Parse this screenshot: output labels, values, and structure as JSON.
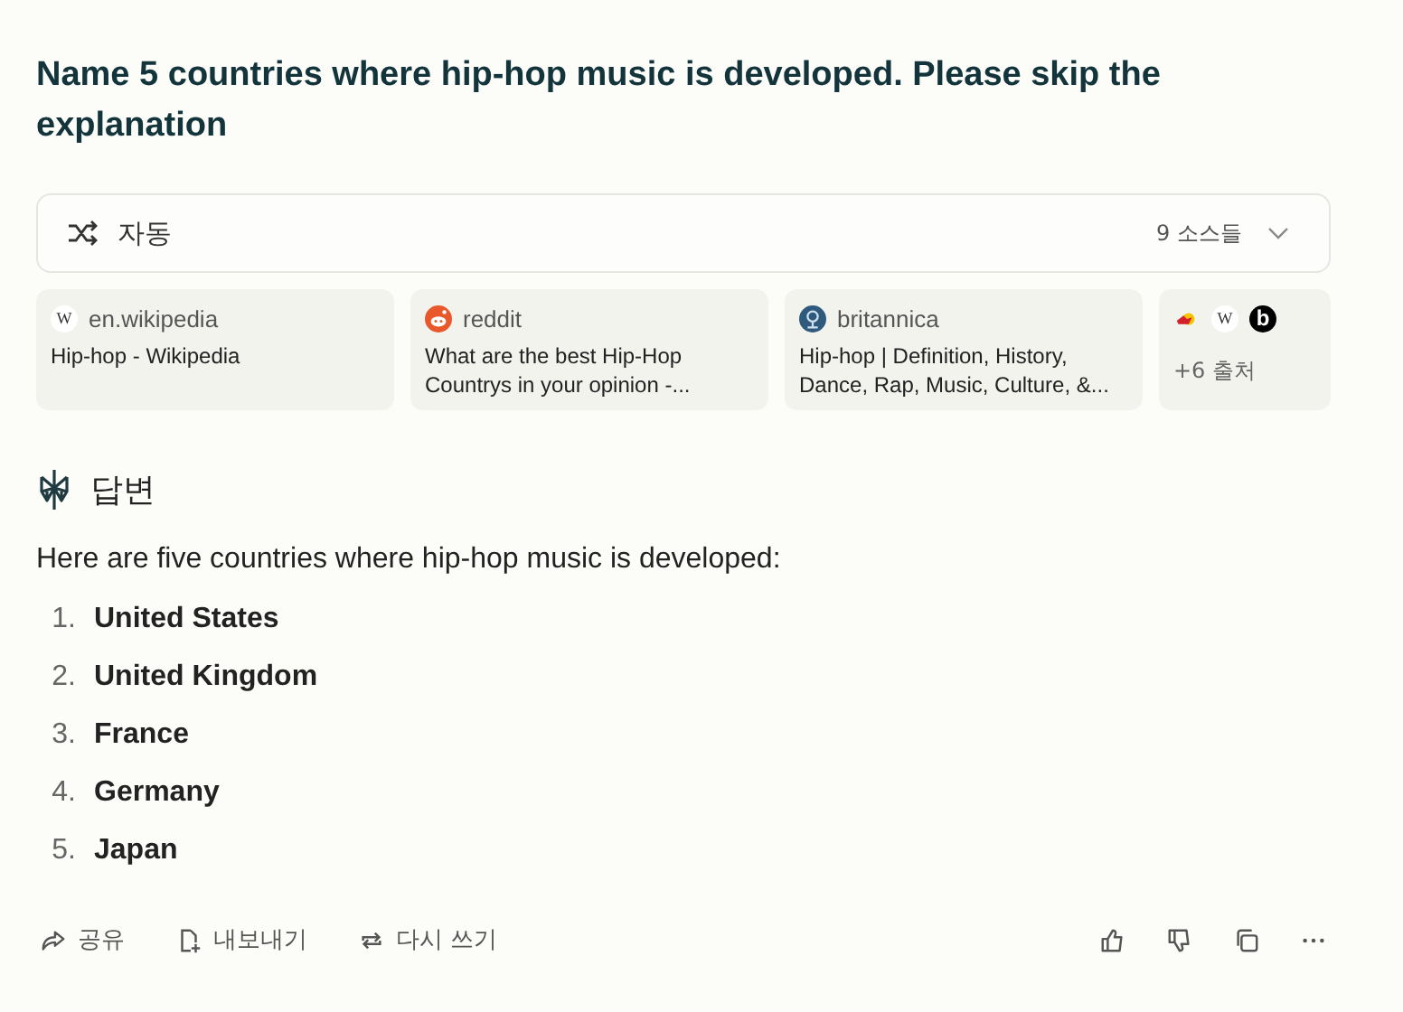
{
  "question": "Name 5 countries where hip-hop music is developed. Please skip the explanation",
  "mode": {
    "label": "자동",
    "sources_count": "9 소스들"
  },
  "sources": [
    {
      "kind": "wikipedia",
      "icon_text": "W",
      "site": "en.wikipedia",
      "title": "Hip-hop - Wikipedia"
    },
    {
      "kind": "reddit",
      "site": "reddit",
      "title": "What are the best Hip-Hop Countrys in your opinion -..."
    },
    {
      "kind": "britannica",
      "site": "britannica",
      "title": "Hip-hop | Definition, History, Dance, Rap, Music, Culture, &..."
    }
  ],
  "more_sources": {
    "icons": [
      {
        "kind": "redbull"
      },
      {
        "kind": "wikipedia",
        "icon_text": "W"
      },
      {
        "kind": "letter",
        "icon_text": "b"
      }
    ],
    "label": "+6 출처"
  },
  "answer": {
    "heading": "답변",
    "intro": "Here are five countries where hip-hop music is developed:",
    "items": [
      {
        "number": "1.",
        "text": "United States"
      },
      {
        "number": "2.",
        "text": "United Kingdom"
      },
      {
        "number": "3.",
        "text": "France"
      },
      {
        "number": "4.",
        "text": "Germany"
      },
      {
        "number": "5.",
        "text": "Japan"
      }
    ]
  },
  "actions": [
    {
      "kind": "share",
      "label": "공유"
    },
    {
      "kind": "export",
      "label": "내보내기"
    },
    {
      "kind": "rewrite",
      "label": "다시 쓰기"
    }
  ],
  "feedback": [
    {
      "kind": "like"
    },
    {
      "kind": "dislike"
    },
    {
      "kind": "copy"
    },
    {
      "kind": "more"
    }
  ]
}
